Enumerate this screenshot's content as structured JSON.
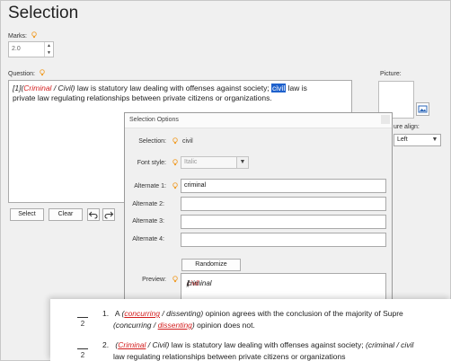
{
  "colors": {
    "accent": "#1e61cc",
    "alternate_red": "#d21c1c",
    "bulb": "#f0a030"
  },
  "page": {
    "title": "Selection"
  },
  "marks": {
    "label": "Marks:",
    "value": "2.0"
  },
  "question": {
    "label": "Question:",
    "line1": {
      "prefix": "[1](",
      "alt1": "Criminal",
      "sep": " / ",
      "alt2": "Civil",
      "close": ")",
      "middle": " law is statutory law dealing with offenses against society; ",
      "selected": "civil",
      "suffix": " law is"
    },
    "line2": "private law regulating relationships between private citizens or organizations."
  },
  "buttons": {
    "select": "Select",
    "clear": "Clear",
    "randomize": "Randomize"
  },
  "picture": {
    "label": "Picture:",
    "align_label": "Picture align:",
    "align_visible": "ure align:",
    "align_value": "Left"
  },
  "dialog": {
    "title": "Selection Options",
    "selection_label": "Selection:",
    "selection_value": "civil",
    "font_style_label": "Font style:",
    "font_style_value": "Italic",
    "alternates": [
      {
        "label": "Alternate 1:",
        "value": "criminal"
      },
      {
        "label": "Alternate 2:",
        "value": ""
      },
      {
        "label": "Alternate 3:",
        "value": ""
      },
      {
        "label": "Alternate 4:",
        "value": ""
      }
    ],
    "preview_label": "Preview:",
    "preview": {
      "open": "(",
      "a": "civil",
      "sep": " / ",
      "b": "criminal",
      "close": ")"
    }
  },
  "output": {
    "blank_number": "2",
    "item1": {
      "n": "1.",
      "pre": "A ",
      "open": "(",
      "a": "concurring",
      "sep": " / ",
      "b": "dissenting",
      "close": ")",
      "text": " opinion agrees with the conclusion of the majority of Supre",
      "l2_open": "(",
      "l2_a": "concurring",
      "l2_sep": " / ",
      "l2_b": "dissenting",
      "l2_close": ")",
      "l2_text": " opinion does not."
    },
    "item2": {
      "n": "2.",
      "open": "(",
      "a": "Criminal",
      "sep": " / ",
      "b": "Civil",
      "close": ")",
      "text": " law is statutory law dealing with offenses against society; ",
      "tail": "(criminal / civil",
      "l2_text": "law regulating relationships between private citizens or organizations"
    }
  }
}
